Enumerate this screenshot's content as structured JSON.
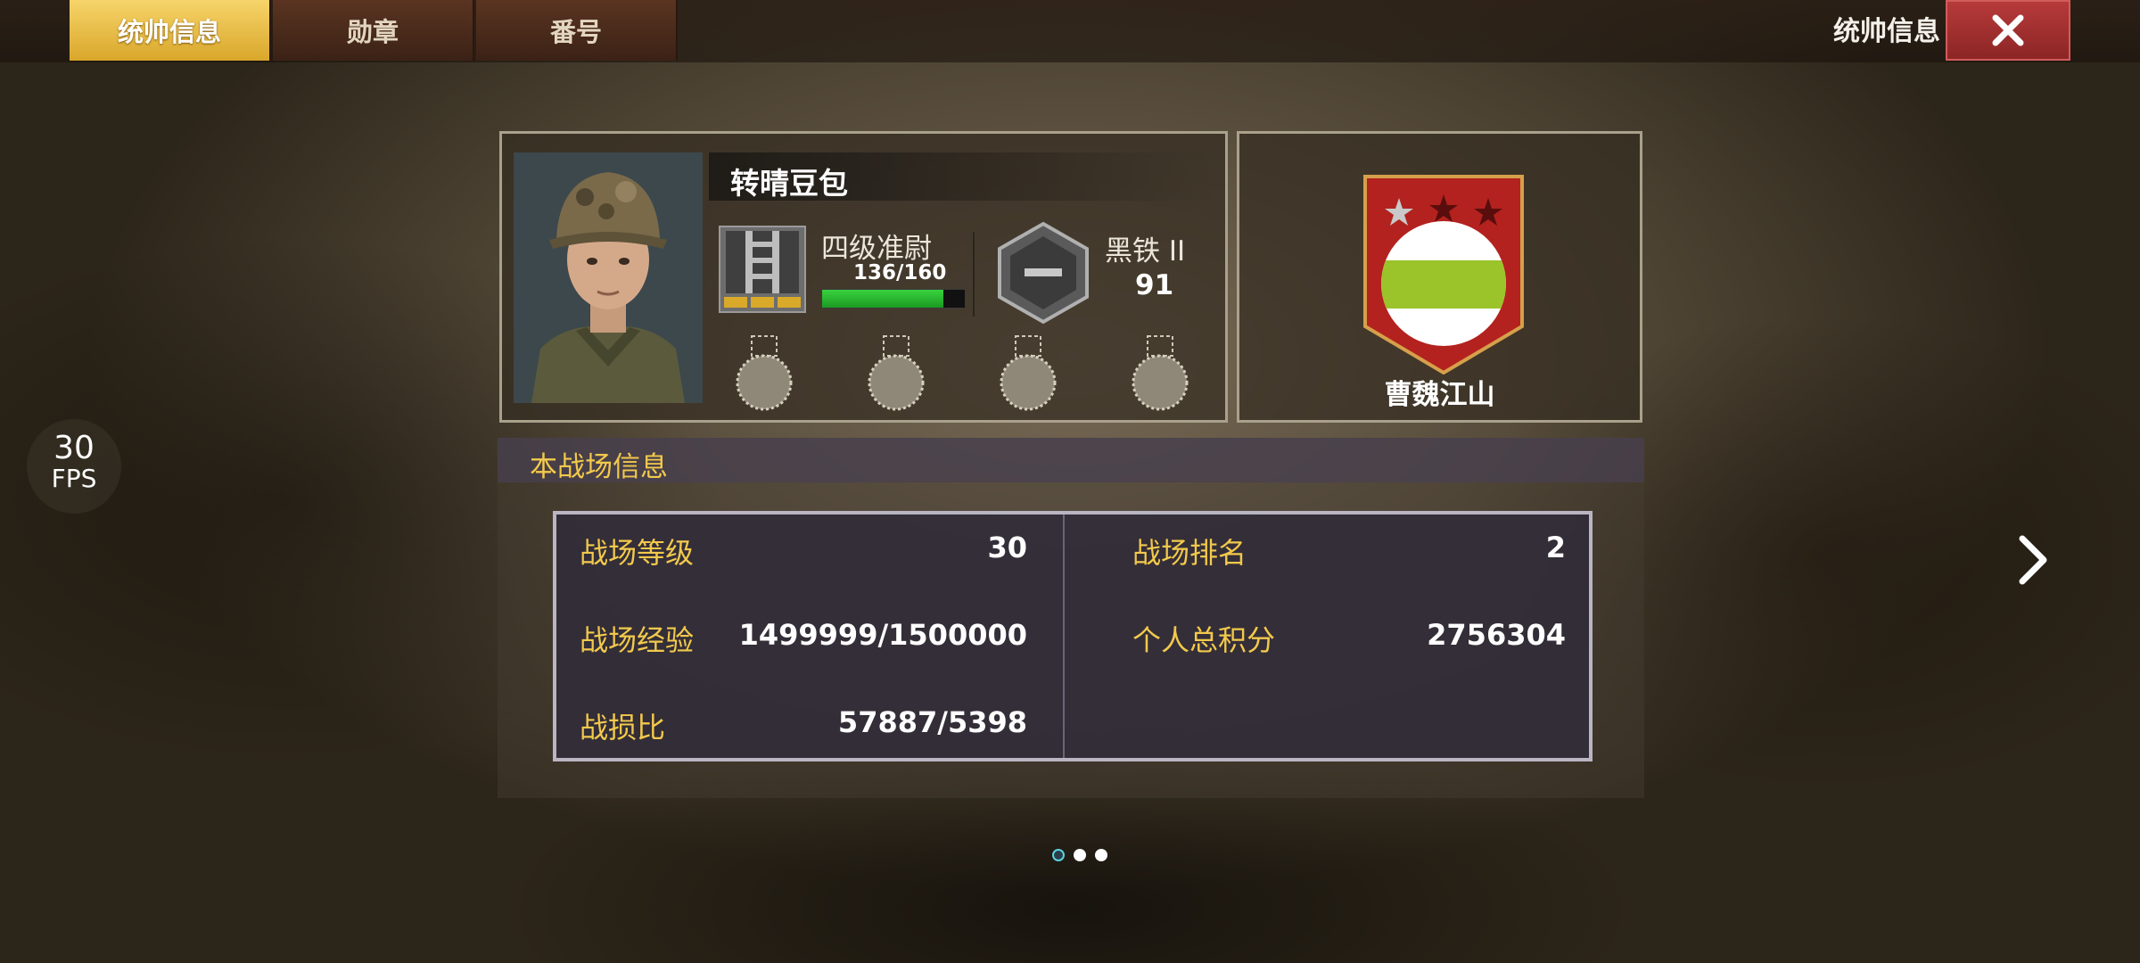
{
  "tabs": [
    {
      "label": "统帅信息",
      "active": true
    },
    {
      "label": "勋章",
      "active": false
    },
    {
      "label": "番号",
      "active": false
    }
  ],
  "header": {
    "title": "统帅信息"
  },
  "fps": {
    "value": "30",
    "label": "FPS"
  },
  "profile": {
    "name": "转晴豆包",
    "rank_name": "四级准尉",
    "xp_text": "136/160",
    "xp_fraction": 0.85,
    "league_name": "黑铁 II",
    "league_score": "91",
    "medal_slots": 4
  },
  "team": {
    "name": "曹魏江山",
    "flag_color": "#9ac42a",
    "stars": 3
  },
  "battlefield": {
    "section_title": "本战场信息",
    "stats": [
      {
        "label": "战场等级",
        "value": "30"
      },
      {
        "label": "战场排名",
        "value": "2"
      },
      {
        "label": "战场经验",
        "value": "1499999/1500000"
      },
      {
        "label": "个人总积分",
        "value": "2756304"
      },
      {
        "label": "战损比",
        "value": "57887/5398"
      }
    ]
  },
  "pager": {
    "count": 3,
    "active_index": 0
  },
  "colors": {
    "accent_gold": "#f2c94c",
    "tab_active": "#e6b840",
    "close_red": "#a83030",
    "xp_green": "#2fbf35"
  }
}
